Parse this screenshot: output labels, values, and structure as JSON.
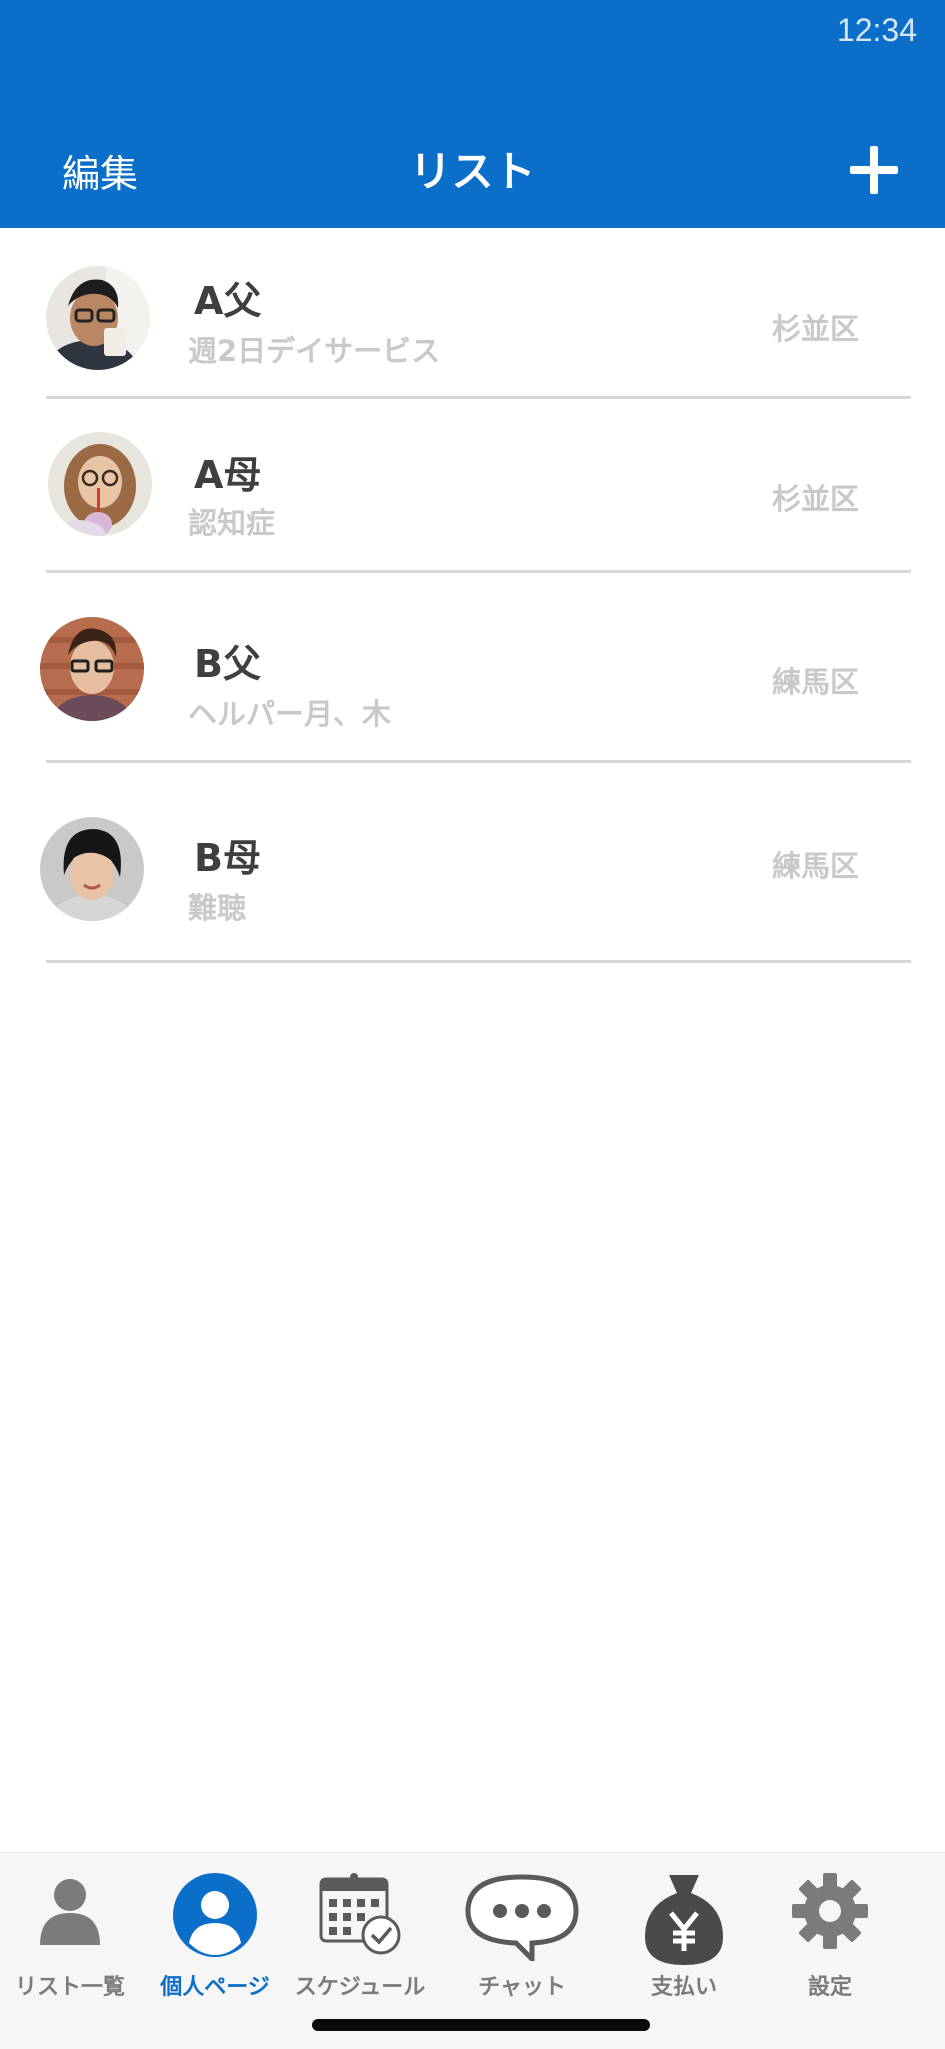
{
  "status_bar": {
    "time": "12:34"
  },
  "header": {
    "edit_label": "編集",
    "title": "リスト",
    "add_icon": "plus-icon"
  },
  "list": {
    "items": [
      {
        "name": "A父",
        "detail": "週2日デイサービス",
        "ward": "杉並区",
        "avatar": "avatar-photo"
      },
      {
        "name": "A母",
        "detail": "認知症",
        "ward": "杉並区",
        "avatar": "avatar-photo"
      },
      {
        "name": "B父",
        "detail": "ヘルパー月、木",
        "ward": "練馬区",
        "avatar": "avatar-photo"
      },
      {
        "name": "B母",
        "detail": "難聴",
        "ward": "練馬区",
        "avatar": "avatar-photo"
      }
    ]
  },
  "tabs": [
    {
      "label": "リスト一覧",
      "icon": "person-icon",
      "active": false
    },
    {
      "label": "個人ページ",
      "icon": "profile-circle-icon",
      "active": true
    },
    {
      "label": "スケジュール",
      "icon": "calendar-check-icon",
      "active": false
    },
    {
      "label": "チャット",
      "icon": "chat-bubble-icon",
      "active": false
    },
    {
      "label": "支払い",
      "icon": "money-bag-icon",
      "active": false
    },
    {
      "label": "設定",
      "icon": "gear-icon",
      "active": false
    }
  ],
  "colors": {
    "brand": "#0b6fc9",
    "text_primary": "#3f3f3f",
    "text_secondary": "#c9c9c9",
    "tab_inactive": "#7b7b7b"
  }
}
